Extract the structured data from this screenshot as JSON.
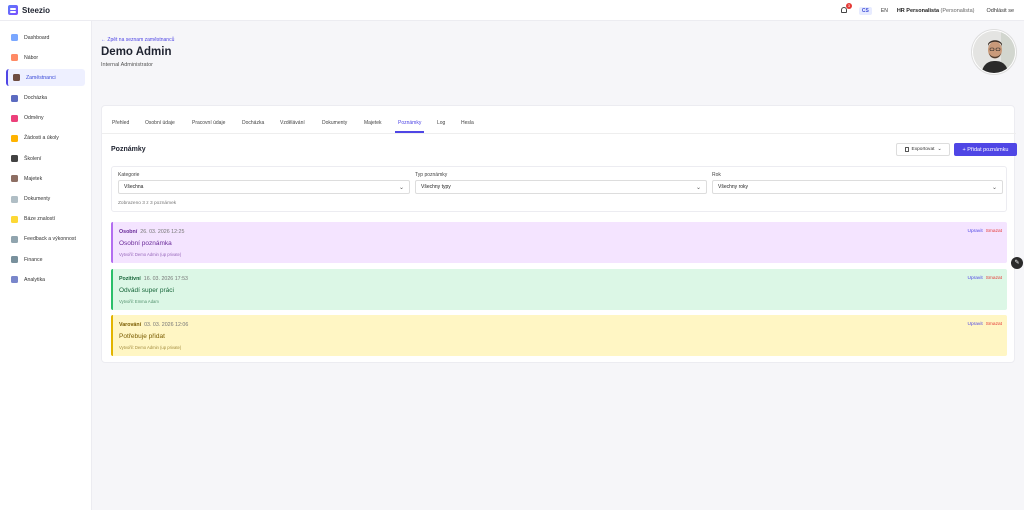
{
  "app": {
    "name": "Steezio"
  },
  "header": {
    "notification_count": "3",
    "languages": [
      "CS",
      "EN"
    ],
    "user_name": "HR Personalista",
    "user_role": "(Personalista)",
    "logout_label": "Odhlásit se"
  },
  "sidebar": {
    "items": [
      {
        "label": "Dashboard",
        "icon": "dashboard-icon",
        "color": "#7aa7ff"
      },
      {
        "label": "Nábor",
        "icon": "target-icon",
        "color": "#ff8a65"
      },
      {
        "label": "Zaměstnanci",
        "icon": "people-icon",
        "color": "#6d4c41"
      },
      {
        "label": "Docházka",
        "icon": "calendar-icon",
        "color": "#5c6bc0"
      },
      {
        "label": "Odměny",
        "icon": "money-icon",
        "color": "#ec407a"
      },
      {
        "label": "Žádosti a úkoly",
        "icon": "tasks-icon",
        "color": "#ffb300"
      },
      {
        "label": "Školení",
        "icon": "graduation-icon",
        "color": "#424242"
      },
      {
        "label": "Majetek",
        "icon": "briefcase-icon",
        "color": "#8d6e63"
      },
      {
        "label": "Dokumenty",
        "icon": "document-icon",
        "color": "#b0bec5"
      },
      {
        "label": "Báze znalostí",
        "icon": "bulb-icon",
        "color": "#fdd835"
      },
      {
        "label": "Feedback a výkonnost",
        "icon": "feedback-icon",
        "color": "#90a4ae"
      },
      {
        "label": "Finance",
        "icon": "bank-icon",
        "color": "#78909c"
      },
      {
        "label": "Analytika",
        "icon": "chart-icon",
        "color": "#7986cb"
      }
    ]
  },
  "page": {
    "back_link": "← Zpět na seznam zaměstnanců",
    "title": "Demo Admin",
    "subtitle": "Internal Administrator"
  },
  "tabs": [
    "Přehled",
    "Osobní údaje",
    "Pracovní údaje",
    "Docházka",
    "Vzdělávání",
    "Dokumenty",
    "Majetek",
    "Poznámky",
    "Log",
    "Hesla"
  ],
  "notes_section": {
    "title": "Poznámky",
    "export_label": "Exportovat",
    "add_label": "+ Přidat poznámku",
    "filter_category_label": "Kategorie",
    "filter_category_value": "Všechna",
    "filter_type_label": "Typ poznámky",
    "filter_type_value": "Všechny typy",
    "filter_year_label": "Rok",
    "filter_year_value": "Všechny roky",
    "count_text": "Zobrazeno 3 z 3 poznámek",
    "edit_label": "Upravit",
    "delete_label": "Smazat"
  },
  "notes": [
    {
      "type": "Osobní",
      "date": "26. 03. 2026 12:25",
      "text": "Osobní poznámka",
      "author": "Vytvořil: Demo Admin (up private)",
      "bg": "#f4e4ff",
      "border": "#b36df0",
      "text_color": "#6a2a9a"
    },
    {
      "type": "Pozitivní",
      "date": "16. 03. 2026 17:53",
      "text": "Odvádí super práci",
      "author": "Vytvořil: Emma Adam",
      "bg": "#dcf7e6",
      "border": "#2bbf6a",
      "text_color": "#17663a"
    },
    {
      "type": "Varování",
      "date": "03. 03. 2026 12:06",
      "text": "Potřebuje přidat",
      "author": "Vytvořil: Demo Admin (up private)",
      "bg": "#fff6c4",
      "border": "#e2b400",
      "text_color": "#7a5c00"
    }
  ]
}
